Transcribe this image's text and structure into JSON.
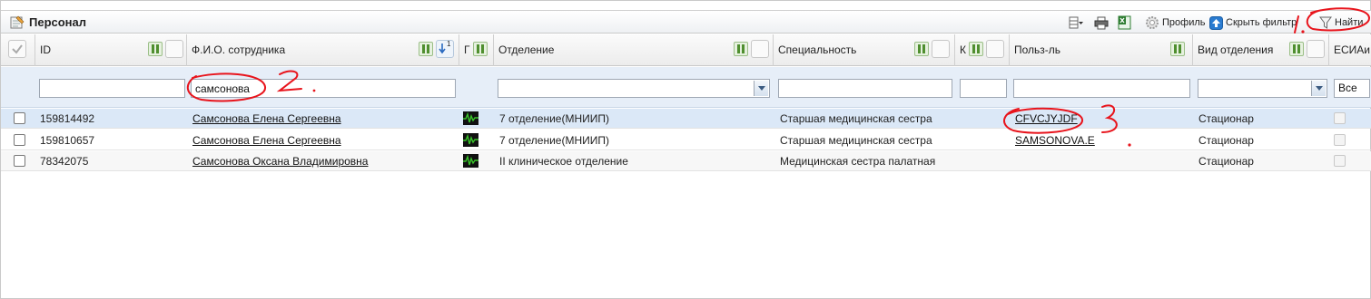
{
  "panel": {
    "title": "Персонал"
  },
  "toolbar": {
    "profile_label": "Профиль",
    "hide_filter_label": "Скрыть фильтр",
    "find_label": "Найти"
  },
  "columns": {
    "id": "ID",
    "fio": "Ф.И.О. сотрудника",
    "sort_index": "1",
    "g": "Г",
    "department": "Отделение",
    "specialty": "Специальность",
    "k": "К",
    "user": "Польз-ль",
    "dept_type": "Вид отделения",
    "esia": "ЕСИАи"
  },
  "filters": {
    "id": "",
    "fio": "самсонова",
    "department": "",
    "specialty": "",
    "k": "",
    "user": "",
    "dept_type": "",
    "esia": "Все"
  },
  "rows": [
    {
      "id": "159814492",
      "fio": "Самсонова Елена Сергеевна",
      "department": "7 отделение(МНИИП)",
      "specialty": "Старшая медицинская сестра",
      "user": "CFVCJYJDF",
      "dept_type": "Стационар"
    },
    {
      "id": "159810657",
      "fio": "Самсонова Елена Сергеевна",
      "department": "7 отделение(МНИИП)",
      "specialty": "Старшая медицинская сестра",
      "user": "SAMSONOVA.E",
      "dept_type": "Стационар"
    },
    {
      "id": "78342075",
      "fio": "Самсонова Оксана Владимировна",
      "department": "II клиническое отделение",
      "specialty": "Медицинская сестра палатная",
      "user": "",
      "dept_type": "Стационар"
    }
  ],
  "annotations": {
    "one": "1.",
    "two": "2",
    "three": "3"
  },
  "colors": {
    "annotation": "#e8141c",
    "selected_row": "#dbe8f7",
    "filter_row": "#e6eef8"
  }
}
